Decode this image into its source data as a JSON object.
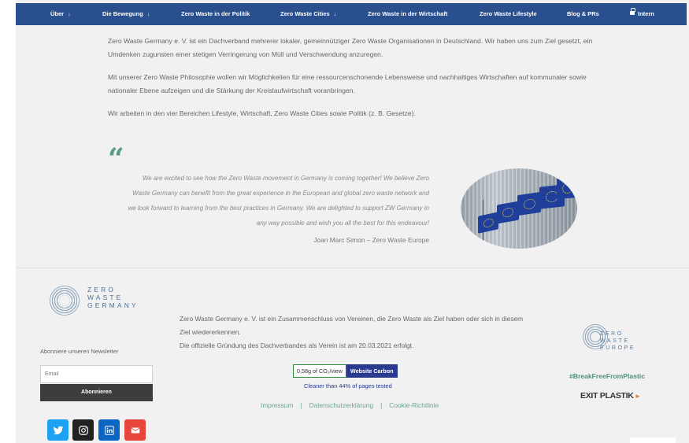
{
  "nav": {
    "items": [
      {
        "label": "Über",
        "caret": "↓"
      },
      {
        "label": "Die Bewegung",
        "caret": "↓"
      },
      {
        "label": "Zero Waste in der Politik",
        "caret": ""
      },
      {
        "label": "Zero Waste Cities",
        "caret": "↓"
      },
      {
        "label": "Zero Waste in der Wirtschaft",
        "caret": ""
      },
      {
        "label": "Zero Waste Lifestyle",
        "caret": ""
      },
      {
        "label": "Blog & PRs",
        "caret": ""
      },
      {
        "label": "Intern",
        "caret": ""
      }
    ]
  },
  "intro": {
    "p1": "Zero Waste Germany e. V. ist ein Dachverband mehrerer lokaler, gemeinnütziger Zero Waste Organisationen in Deutschland. Wir haben uns zum Ziel gesetzt, ein Umdenken zugunsten einer stetigen Verringerung von Müll und Verschwendung anzuregen.",
    "p2": "Mit unserer Zero Waste Philosophie wollen wir Möglichkeiten für eine ressourcenschonende Lebensweise und nachhaltiges Wirtschaften auf kommunaler sowie nationaler Ebene aufzeigen und die Stärkung der Kreislaufwirtschaft voranbringen.",
    "p3": "Wir arbeiten in den vier Bereichen Lifestyle, Wirtschaft, Zero Waste Cities sowie Politik (z. B. Gesetze)."
  },
  "quote": {
    "mark": "“",
    "text": "We are excited to see how the Zero Waste movement in Germany is coming together! We believe Zero Waste Germany can benefit from the great experience in the European and global zero waste network and we look forward to learning from the best practices in Germany. We are delighted to support ZW Germany in any way possible and wish you all the best for this endeavour!",
    "author": "Joan Marc Simon – Zero Waste Europe"
  },
  "footer": {
    "logo_words": [
      "ZERO",
      "WASTE",
      "GERMANY"
    ],
    "newsletter_label": "Abonniere unseren Newsletter",
    "email_placeholder": "Email",
    "subscribe_label": "Abonnieren",
    "about_line1": "Zero Waste Germany e. V. ist ein Zusammenschluss von Vereinen, die Zero Waste als Ziel haben oder sich in diesem Ziel wiedererkennen.",
    "about_line2": "Die offizielle Gründung des Dachverbandes als Verein ist am 20.03.2021 erfolgt.",
    "badge_left": "0,58g of CO₂/view",
    "badge_right": "Website Carbon",
    "cleaner_text": "Cleaner than 44% of pages tested",
    "links": [
      "Impressum",
      "Datenschutzerklärung",
      "Cookie-Richtlinie"
    ],
    "link_sep": "|",
    "zwe_logo_words": [
      "ZERO",
      "WASTE",
      "EUROPE"
    ],
    "hashtag": "#BreakFreeFromPlastic",
    "exit_plastik": "EXIT PLASTIK",
    "exit_arrow": "▸"
  },
  "social": [
    {
      "name": "twitter",
      "color": "#1da1f2"
    },
    {
      "name": "instagram",
      "color": "#222222"
    },
    {
      "name": "linkedin",
      "color": "#0a66c2"
    },
    {
      "name": "email",
      "color": "#e8453c"
    }
  ]
}
